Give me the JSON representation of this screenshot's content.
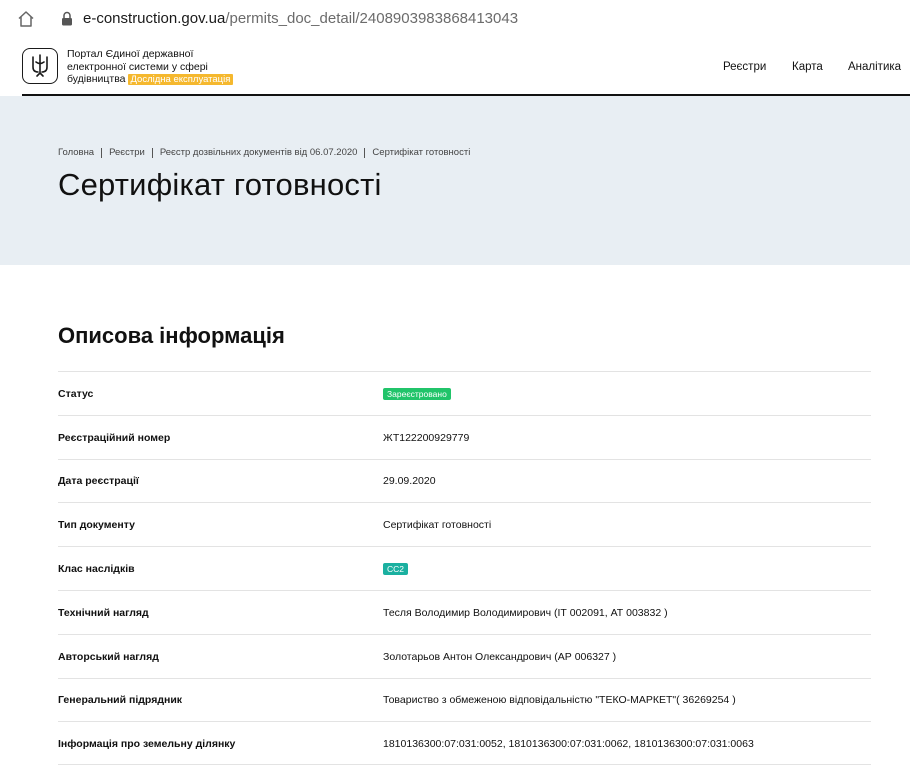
{
  "browser": {
    "url_host": "e-construction.gov.ua",
    "url_path": "/permits_doc_detail/2408903983868413043"
  },
  "header": {
    "logo_lines": [
      "Портал Єдиної державної",
      "електронної системи у сфері",
      "будівництва"
    ],
    "beta_badge": "Дослідна експлуатація",
    "nav": [
      "Реєстри",
      "Карта",
      "Аналітика"
    ]
  },
  "hero": {
    "breadcrumbs": [
      "Головна",
      "Реєстри",
      "Реєстр дозвільних документів від 06.07.2020",
      "Сертифікат готовності"
    ],
    "title": "Сертифікат готовності"
  },
  "section": {
    "title": "Описова інформація",
    "rows": [
      {
        "label": "Статус",
        "value": "Зареєстровано",
        "badge": "status"
      },
      {
        "label": "Реєстраційний номер",
        "value": "ЖТ122200929779"
      },
      {
        "label": "Дата реєстрації",
        "value": "29.09.2020"
      },
      {
        "label": "Тип документу",
        "value": "Сертифікат готовності"
      },
      {
        "label": "Клас наслідків",
        "value": "СС2",
        "badge": "class"
      },
      {
        "label": "Технічний нагляд",
        "value": "Тесля Володимир Володимирович (ІТ 002091, АТ 003832 )"
      },
      {
        "label": "Авторський нагляд",
        "value": "Золотарьов Антон Олександрович (АР 006327 )"
      },
      {
        "label": "Генеральний підрядник",
        "value": "Товариство з обмеженою відповідальністю \"ТЕКО-МАРКЕТ\"( 36269254 )"
      },
      {
        "label": "Інформація про земельну ділянку",
        "value": "1810136300:07:031:0052, 1810136300:07:031:0062, 1810136300:07:031:0063"
      }
    ]
  },
  "colors": {
    "hero_bg": "#e8eef3",
    "beta_badge": "#f5b82e",
    "status_badge": "#21c46a",
    "class_badge": "#1ab0a0"
  },
  "icons": [
    "home-icon",
    "lock-icon",
    "trident-icon"
  ]
}
